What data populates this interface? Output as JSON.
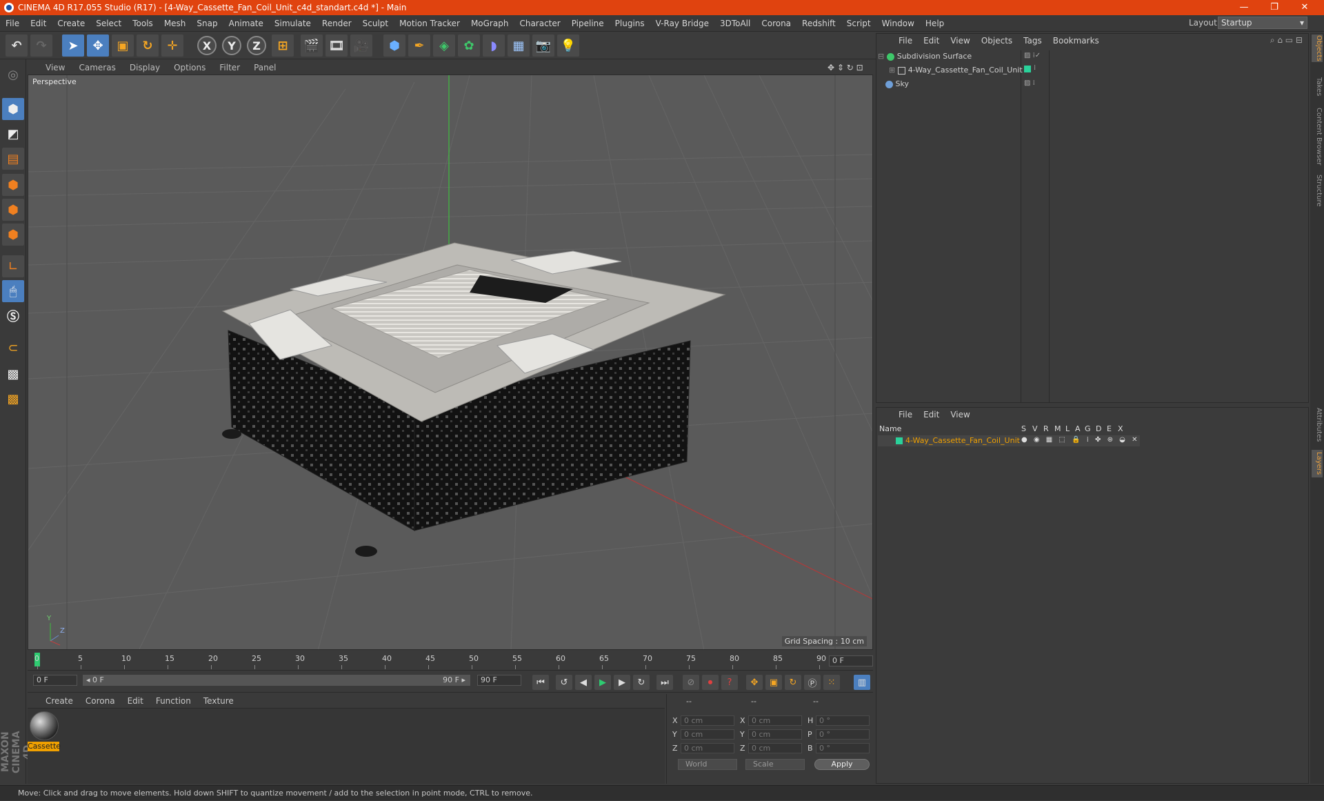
{
  "window": {
    "title": "CINEMA 4D R17.055 Studio (R17) - [4-Way_Cassette_Fan_Coil_Unit_c4d_standart.c4d *] - Main",
    "controls": [
      "—",
      "❐",
      "✕"
    ]
  },
  "menubar": {
    "items": [
      "File",
      "Edit",
      "Create",
      "Select",
      "Tools",
      "Mesh",
      "Snap",
      "Animate",
      "Simulate",
      "Render",
      "Sculpt",
      "Motion Tracker",
      "MoGraph",
      "Character",
      "Pipeline",
      "Plugins",
      "V-Ray Bridge",
      "3DToAll",
      "Corona",
      "Redshift",
      "Script",
      "Window",
      "Help"
    ],
    "layout_label": "Layout:",
    "layout_value": "Startup"
  },
  "toolbar": {
    "undo": "↶",
    "redo": "↷",
    "axis_x": "X",
    "axis_y": "Y",
    "axis_z": "Z"
  },
  "viewport": {
    "menu": [
      "View",
      "Cameras",
      "Display",
      "Options",
      "Filter",
      "Panel"
    ],
    "label": "Perspective",
    "grid_spacing": "Grid Spacing : 10 cm",
    "axis_y": "Y",
    "axis_z": "Z"
  },
  "timeline": {
    "ticks": [
      "0",
      "5",
      "10",
      "15",
      "20",
      "25",
      "30",
      "35",
      "40",
      "45",
      "50",
      "55",
      "60",
      "65",
      "70",
      "75",
      "80",
      "85",
      "90"
    ],
    "current_frame": "0 F",
    "start_field": "0 F",
    "range_start": "◂ 0 F",
    "range_end": "90 F ▸",
    "end_field": "90 F"
  },
  "material_manager": {
    "menu": [
      "Create",
      "Corona",
      "Edit",
      "Function",
      "Texture"
    ],
    "material_name": "Cassette"
  },
  "coordinates": {
    "headers": [
      "--",
      "--",
      "--"
    ],
    "rows": [
      {
        "l1": "X",
        "v1": "0 cm",
        "l2": "X",
        "v2": "0 cm",
        "l3": "H",
        "v3": "0 °"
      },
      {
        "l1": "Y",
        "v1": "0 cm",
        "l2": "Y",
        "v2": "0 cm",
        "l3": "P",
        "v3": "0 °"
      },
      {
        "l1": "Z",
        "v1": "0 cm",
        "l2": "Z",
        "v2": "0 cm",
        "l3": "B",
        "v3": "0 °"
      }
    ],
    "mode_world": "World",
    "mode_scale": "Scale",
    "apply_label": "Apply"
  },
  "object_manager": {
    "menu": [
      "File",
      "Edit",
      "View",
      "Objects",
      "Tags",
      "Bookmarks"
    ],
    "objects": [
      {
        "name": "Subdivision Surface",
        "icon_color": "#3ec86a"
      },
      {
        "name": "4-Way_Cassette_Fan_Coil_Unit",
        "icon_color": "#2ad19a"
      },
      {
        "name": "Sky",
        "icon_color": "#6f9fd8"
      }
    ]
  },
  "layer_manager": {
    "menu": [
      "File",
      "Edit",
      "View"
    ],
    "columns": [
      "Name",
      "S",
      "V",
      "R",
      "M",
      "L",
      "A",
      "G",
      "D",
      "E",
      "X"
    ],
    "layers": [
      {
        "name": "4-Way_Cassette_Fan_Coil_Unit",
        "color": "#2ad19a"
      }
    ]
  },
  "right_tabs": [
    "Objects",
    "Takes",
    "Content Browser",
    "Structure",
    "Attributes",
    "Layers"
  ],
  "maxon_logo": "MAXON CINEMA 4D",
  "status": "Move: Click and drag to move elements. Hold down SHIFT to quantize movement / add to the selection in point mode, CTRL to remove.",
  "colors": {
    "titlebar": "#e0430f",
    "accent": "#4b7fbf",
    "material_label": "#f0a000"
  }
}
